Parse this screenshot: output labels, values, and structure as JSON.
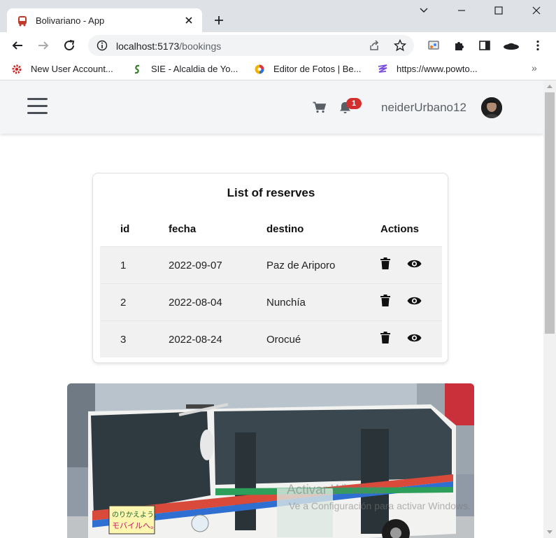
{
  "browser": {
    "tab_title": "Bolivariano - App",
    "url_host": "localhost:5173",
    "url_path": "/bookings",
    "bookmarks": [
      {
        "label": "New User Account..."
      },
      {
        "label": "SIE - Alcaldia de Yo..."
      },
      {
        "label": "Editor de Fotos | Be..."
      },
      {
        "label": "https://www.powto..."
      }
    ],
    "bookmarks_more": "»"
  },
  "header": {
    "notification_count": "1",
    "username": "neiderUrbano12"
  },
  "reserves": {
    "title": "List of reserves",
    "columns": [
      "id",
      "fecha",
      "destino",
      "Actions"
    ],
    "rows": [
      {
        "id": "1",
        "fecha": "2022-09-07",
        "destino": "Paz de Ariporo"
      },
      {
        "id": "2",
        "fecha": "2022-08-04",
        "destino": "Nunchía"
      },
      {
        "id": "3",
        "fecha": "2022-08-24",
        "destino": "Orocué"
      }
    ]
  },
  "bus_sign": {
    "line1": "のりかえよう、",
    "line2": "モバイルへ。"
  },
  "watermark": {
    "line1": "Activar Windows",
    "line2": "Ve a Configuración para activar Windows."
  },
  "colors": {
    "badge": "#d32f2f",
    "app_bar": "#f4f5f7",
    "row_background": "#f1f1f1"
  }
}
